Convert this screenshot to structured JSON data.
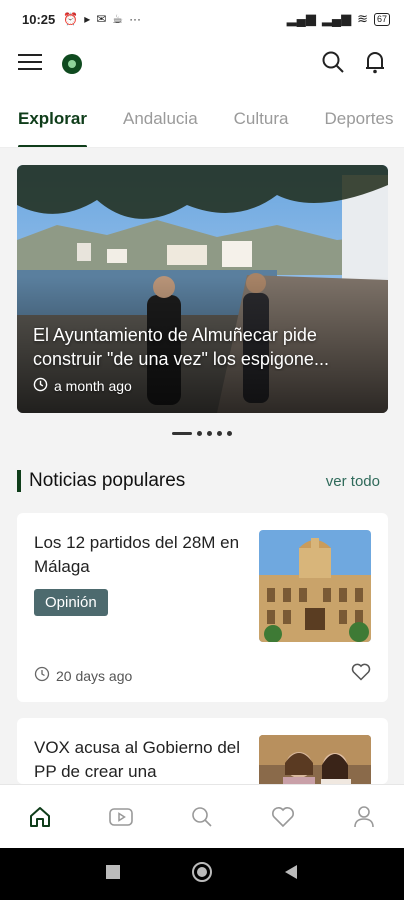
{
  "status_bar": {
    "time": "10:25",
    "battery": "67"
  },
  "tabs": [
    {
      "label": "Explorar",
      "active": true
    },
    {
      "label": "Andalucia"
    },
    {
      "label": "Cultura"
    },
    {
      "label": "Deportes"
    }
  ],
  "hero": {
    "title_line1": "El Ayuntamiento de Almuñecar pide",
    "title_line2": "construir \"de una vez\" los espigone...",
    "time_ago": "a month ago",
    "pages": 5,
    "current_page": 1
  },
  "section": {
    "heading": "Noticias populares",
    "more_label": "ver todo"
  },
  "articles": [
    {
      "title": "Los 12 partidos del 28M en Málaga",
      "badge": "Opinión",
      "time_ago": "20 days ago"
    },
    {
      "title": "VOX acusa al Gobierno del PP de crear una"
    }
  ],
  "colors": {
    "accent": "#0f3d1a",
    "badge": "#4d6a6e",
    "link": "#2f6a5a"
  }
}
